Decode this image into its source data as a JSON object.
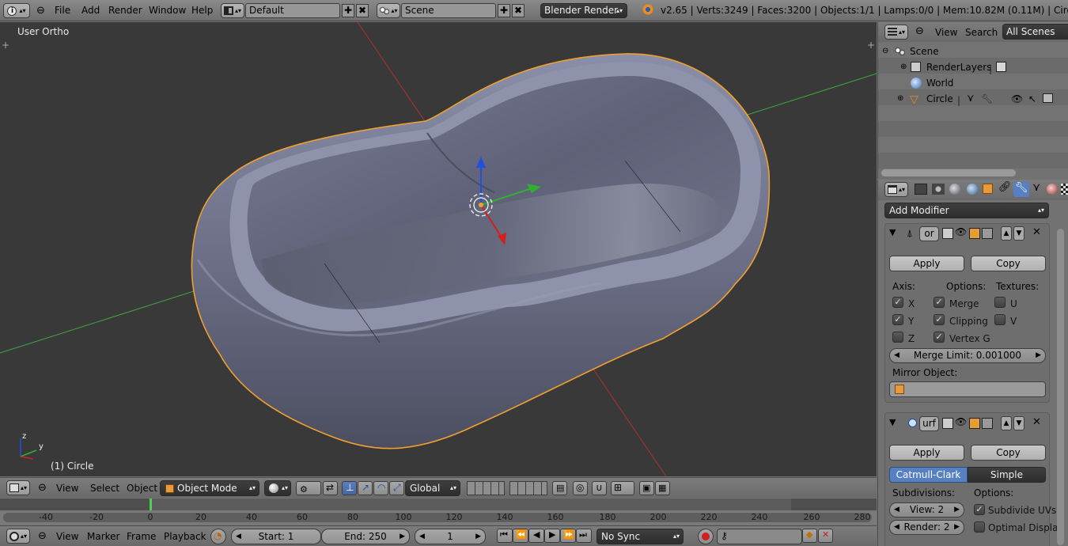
{
  "top_header": {
    "menus": [
      "File",
      "Add",
      "Render",
      "Window",
      "Help"
    ],
    "screen_layout": "Default",
    "scene": "Scene",
    "render_engine": "Blender Render",
    "stats": "v2.65 | Verts:3249 | Faces:3200 | Objects:1/1 | Lamps:0/0 | Mem:10.82M (0.11M) | Circle"
  },
  "viewport": {
    "view_label": "User Ortho",
    "object_label": "(1) Circle",
    "axis_labels": {
      "z": "z",
      "y": "y"
    }
  },
  "view3d_header": {
    "menus": [
      "View",
      "Select",
      "Object"
    ],
    "mode": "Object Mode",
    "orientation": "Global"
  },
  "timeline": {
    "ticks": [
      "-40",
      "-20",
      "0",
      "20",
      "40",
      "60",
      "80",
      "100",
      "120",
      "140",
      "160",
      "180",
      "200",
      "220",
      "240",
      "260",
      "280"
    ],
    "menus": [
      "View",
      "Marker",
      "Frame",
      "Playback"
    ],
    "start": "Start: 1",
    "end": "End: 250",
    "current": "1",
    "sync": "No Sync"
  },
  "outliner": {
    "menus": [
      "View",
      "Search"
    ],
    "filter": "All Scenes",
    "items": [
      "Scene",
      "RenderLayers",
      "World",
      "Circle"
    ]
  },
  "properties": {
    "add_modifier": "Add Modifier",
    "mirror": {
      "name": "or",
      "apply": "Apply",
      "copy": "Copy",
      "axis_label": "Axis:",
      "options_label": "Options:",
      "textures_label": "Textures:",
      "axes": [
        {
          "label": "X",
          "checked": true
        },
        {
          "label": "Y",
          "checked": true
        },
        {
          "label": "Z",
          "checked": false
        }
      ],
      "options": [
        {
          "label": "Merge",
          "checked": true
        },
        {
          "label": "Clipping",
          "checked": true
        },
        {
          "label": "Vertex G",
          "checked": true
        }
      ],
      "textures": [
        {
          "label": "U",
          "checked": false
        },
        {
          "label": "V",
          "checked": false
        }
      ],
      "merge_limit": "Merge Limit: 0.001000",
      "mirror_object_label": "Mirror Object:"
    },
    "subsurf": {
      "name": "urf",
      "apply": "Apply",
      "copy": "Copy",
      "catmull": "Catmull-Clark",
      "simple": "Simple",
      "subdivisions_label": "Subdivisions:",
      "options_label": "Options:",
      "view": "View: 2",
      "render": "Render: 2",
      "subdivide_uvs": "Subdivide UVs",
      "optimal_display": "Optimal Displa"
    }
  },
  "colors": {
    "viewport_bg": "#393939",
    "selection_outline": "#f0a030",
    "x_axis": "#c03030",
    "y_axis": "#40b040",
    "z_axis": "#2050e0",
    "catmull_active": "#5680c2"
  }
}
